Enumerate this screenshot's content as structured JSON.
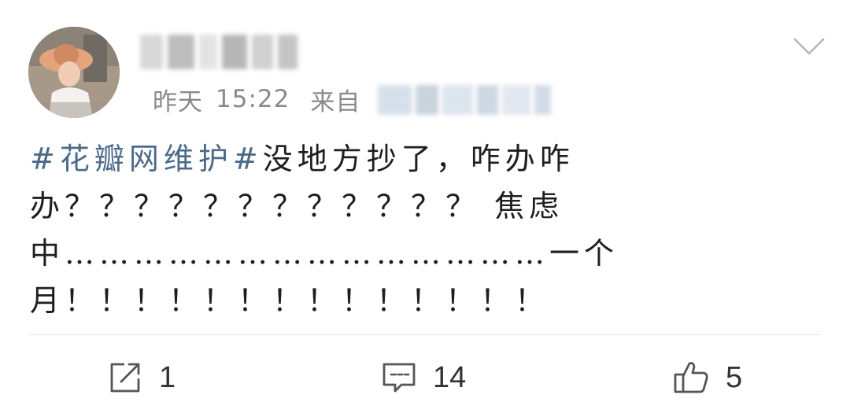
{
  "post": {
    "username": "",
    "meta": {
      "date": "昨天",
      "time": "15:22",
      "from_label": "来自",
      "source": ""
    },
    "content_lines": [
      {
        "hashtag": "#花瓣网维护#",
        "text": "没地方抄了，咋办咋"
      },
      {
        "hashtag": "",
        "text": "办？？？？？？？？？？？？ 焦虑"
      },
      {
        "hashtag": "",
        "text": "中……………………………………一个"
      },
      {
        "hashtag": "",
        "text": "月！！！！！！！！！！！！！！"
      }
    ],
    "actions": {
      "repost_count": "1",
      "comment_count": "14",
      "like_count": "5"
    }
  },
  "icons": {
    "avatar": "avatar-photo",
    "menu": "chevron-down-icon",
    "repost": "repost-icon",
    "comment": "comment-icon",
    "like": "thumbs-up-icon"
  },
  "colors": {
    "hashtag": "#4c6b8a",
    "meta_text": "#8a8a8a",
    "icon": "#555555"
  }
}
